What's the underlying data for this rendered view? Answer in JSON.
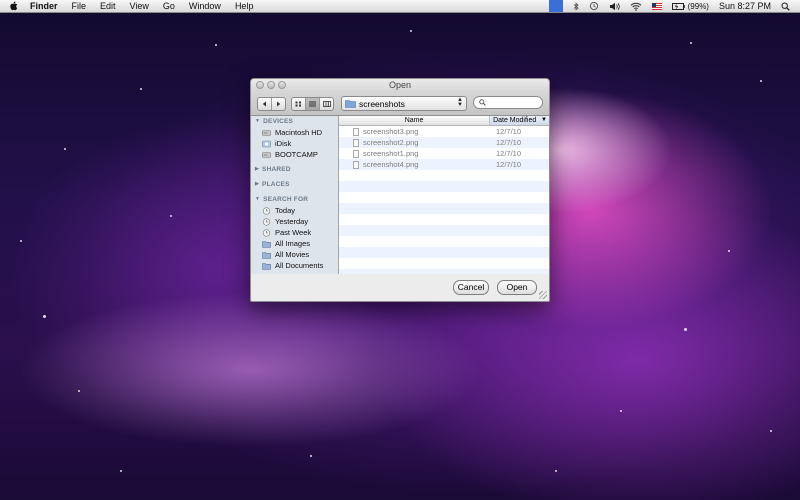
{
  "menubar": {
    "app_name": "Finder",
    "items": [
      "File",
      "Edit",
      "View",
      "Go",
      "Window",
      "Help"
    ],
    "battery": "(99%)",
    "clock": "Sun 8:27 PM"
  },
  "dialog": {
    "title": "Open",
    "path_popup": "screenshots",
    "search_placeholder": "",
    "sidebar": {
      "devices_header": "DEVICES",
      "devices": [
        "Macintosh HD",
        "iDisk",
        "BOOTCAMP"
      ],
      "shared_header": "SHARED",
      "places_header": "PLACES",
      "search_header": "SEARCH FOR",
      "searches": [
        "Today",
        "Yesterday",
        "Past Week",
        "All Images",
        "All Movies",
        "All Documents"
      ]
    },
    "columns": {
      "name": "Name",
      "date": "Date Modified"
    },
    "files": [
      {
        "name": "screenshot3.png",
        "date": "12/7/10"
      },
      {
        "name": "screenshot2.png",
        "date": "12/7/10"
      },
      {
        "name": "screenshot1.png",
        "date": "12/7/10"
      },
      {
        "name": "screenshot4.png",
        "date": "12/7/10"
      }
    ],
    "buttons": {
      "cancel": "Cancel",
      "open": "Open"
    }
  },
  "colors": {
    "sidebar_bg": "#dde4ec",
    "row_stripe": "#edf3fe",
    "spotlight_highlight": "#3b6fd8"
  }
}
